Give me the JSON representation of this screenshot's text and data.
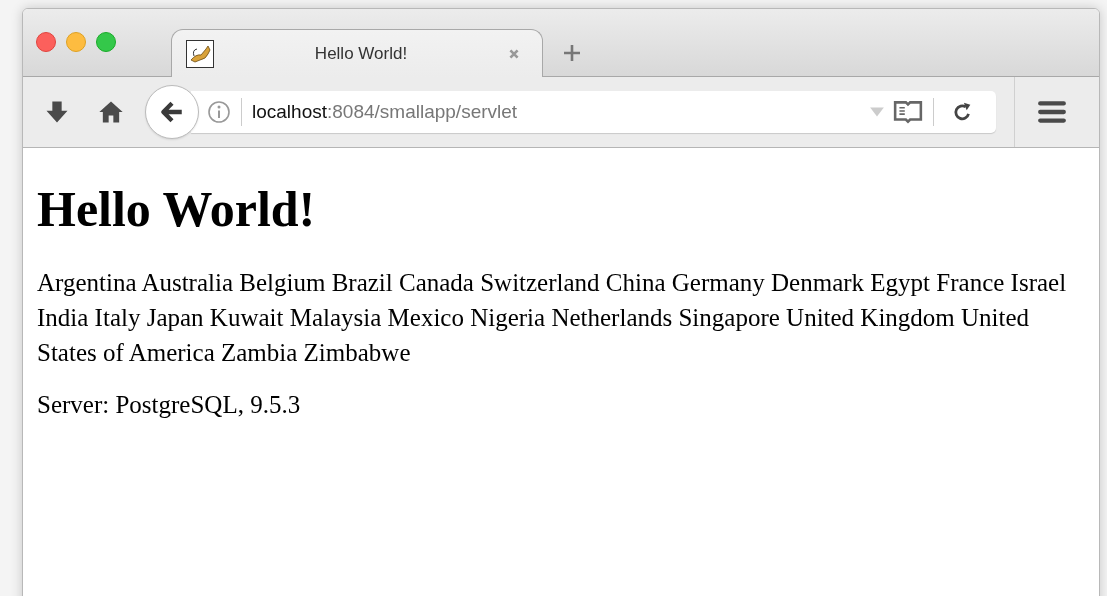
{
  "tabs": [
    {
      "title": "Hello World!",
      "selected": true
    }
  ],
  "address_bar": {
    "host": "localhost",
    "path": ":8084/smallapp/servlet"
  },
  "page": {
    "heading": "Hello World!",
    "paragraphs": [
      "Argentina Australia Belgium Brazil Canada Switzerland China Germany Denmark Egypt France Israel India Italy Japan Kuwait Malaysia Mexico Nigeria Netherlands Singapore United Kingdom United States of America Zambia Zimbabwe",
      "Server: PostgreSQL, 9.5.3"
    ]
  }
}
